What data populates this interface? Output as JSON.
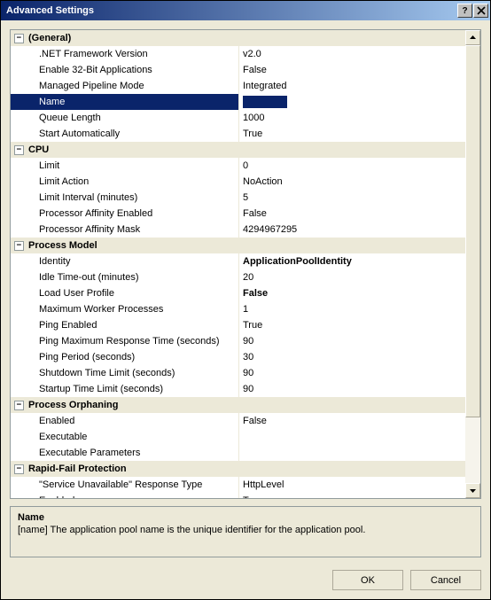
{
  "title": "Advanced Settings",
  "categories": [
    {
      "name": "(General)",
      "props": [
        {
          "label": ".NET Framework Version",
          "value": "v2.0"
        },
        {
          "label": "Enable 32-Bit Applications",
          "value": "False"
        },
        {
          "label": "Managed Pipeline Mode",
          "value": "Integrated"
        },
        {
          "label": "Name",
          "value": "",
          "selected": true
        },
        {
          "label": "Queue Length",
          "value": "1000"
        },
        {
          "label": "Start Automatically",
          "value": "True"
        }
      ]
    },
    {
      "name": "CPU",
      "props": [
        {
          "label": "Limit",
          "value": "0"
        },
        {
          "label": "Limit Action",
          "value": "NoAction"
        },
        {
          "label": "Limit Interval (minutes)",
          "value": "5"
        },
        {
          "label": "Processor Affinity Enabled",
          "value": "False"
        },
        {
          "label": "Processor Affinity Mask",
          "value": "4294967295"
        }
      ]
    },
    {
      "name": "Process Model",
      "props": [
        {
          "label": "Identity",
          "value": "ApplicationPoolIdentity",
          "bold": true
        },
        {
          "label": "Idle Time-out (minutes)",
          "value": "20"
        },
        {
          "label": "Load User Profile",
          "value": "False",
          "bold": true
        },
        {
          "label": "Maximum Worker Processes",
          "value": "1"
        },
        {
          "label": "Ping Enabled",
          "value": "True"
        },
        {
          "label": "Ping Maximum Response Time (seconds)",
          "value": "90"
        },
        {
          "label": "Ping Period (seconds)",
          "value": "30"
        },
        {
          "label": "Shutdown Time Limit (seconds)",
          "value": "90"
        },
        {
          "label": "Startup Time Limit (seconds)",
          "value": "90"
        }
      ]
    },
    {
      "name": "Process Orphaning",
      "props": [
        {
          "label": "Enabled",
          "value": "False"
        },
        {
          "label": "Executable",
          "value": ""
        },
        {
          "label": "Executable Parameters",
          "value": ""
        }
      ]
    },
    {
      "name": "Rapid-Fail Protection",
      "props": [
        {
          "label": "\"Service Unavailable\" Response Type",
          "value": "HttpLevel"
        },
        {
          "label": "Enabled",
          "value": "True"
        }
      ]
    }
  ],
  "description": {
    "title": "Name",
    "text": "[name] The application pool name is the unique identifier for the application pool."
  },
  "buttons": {
    "ok": "OK",
    "cancel": "Cancel"
  }
}
